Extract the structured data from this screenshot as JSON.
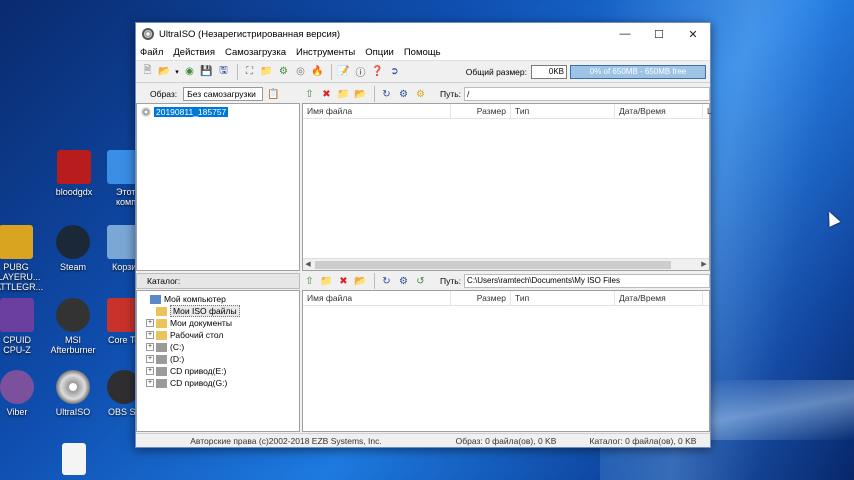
{
  "desktop": {
    "icons": [
      {
        "label": "bloodgdx",
        "color": "#b81c1c"
      },
      {
        "label": "Этот компьютер",
        "color": "#3a8ee6"
      },
      {
        "label": "PUBG PLAYERU... BATTLEGR...",
        "color": "#d9a520"
      },
      {
        "label": "Steam",
        "color": "#1b2838"
      },
      {
        "label": "Корзина",
        "color": "#7aa7d6"
      },
      {
        "label": "CPUID CPU-Z",
        "color": "#6b3fa0"
      },
      {
        "label": "MSI Afterburner",
        "color": "#333333"
      },
      {
        "label": "Core Temp",
        "color": "#c8322b"
      },
      {
        "label": "Viber",
        "color": "#7b519d"
      },
      {
        "label": "UltraISO",
        "color": "#9a9a9a"
      },
      {
        "label": "OBS Studio",
        "color": "#302e31"
      }
    ]
  },
  "window": {
    "title": "UltraISO (Незарегистрированная версия)",
    "menu": [
      "Файл",
      "Действия",
      "Самозагрузка",
      "Инструменты",
      "Опции",
      "Помощь"
    ],
    "toolbar": {
      "total_size_label": "Общий размер:",
      "total_size_value": "0KB",
      "capacity_text": "0% of 650MB - 650MB free"
    },
    "image_bar": {
      "label": "Образ:",
      "boot_value": "Без самозагрузки"
    },
    "upper_path": {
      "label": "Путь:",
      "value": "/"
    },
    "iso_tree": {
      "root": "20190811_185757"
    },
    "columns": [
      "Имя файла",
      "Размер",
      "Тип",
      "Дата/Время",
      "L"
    ],
    "catalog_label": "Каталог:",
    "lower_path": {
      "label": "Путь:",
      "value": "C:\\Users\\ramtech\\Documents\\My ISO Files"
    },
    "local_tree": [
      {
        "label": "Мой компьютер",
        "level": 0,
        "expander": ""
      },
      {
        "label": "Мои ISO файлы",
        "level": 1,
        "expander": "",
        "selected": true
      },
      {
        "label": "Мои документы",
        "level": 1,
        "expander": "+"
      },
      {
        "label": "Рабочий стол",
        "level": 1,
        "expander": "+"
      },
      {
        "label": "(C:)",
        "level": 1,
        "expander": "+"
      },
      {
        "label": "(D:)",
        "level": 1,
        "expander": "+"
      },
      {
        "label": "CD привод(E:)",
        "level": 1,
        "expander": "+"
      },
      {
        "label": "CD привод(G:)",
        "level": 1,
        "expander": "+"
      }
    ],
    "status": {
      "copyright": "Авторские права (c)2002-2018 EZB Systems, Inc.",
      "image": "Образ: 0 файла(ов), 0 KB",
      "catalog": "Каталог: 0 файла(ов), 0 KB"
    }
  }
}
